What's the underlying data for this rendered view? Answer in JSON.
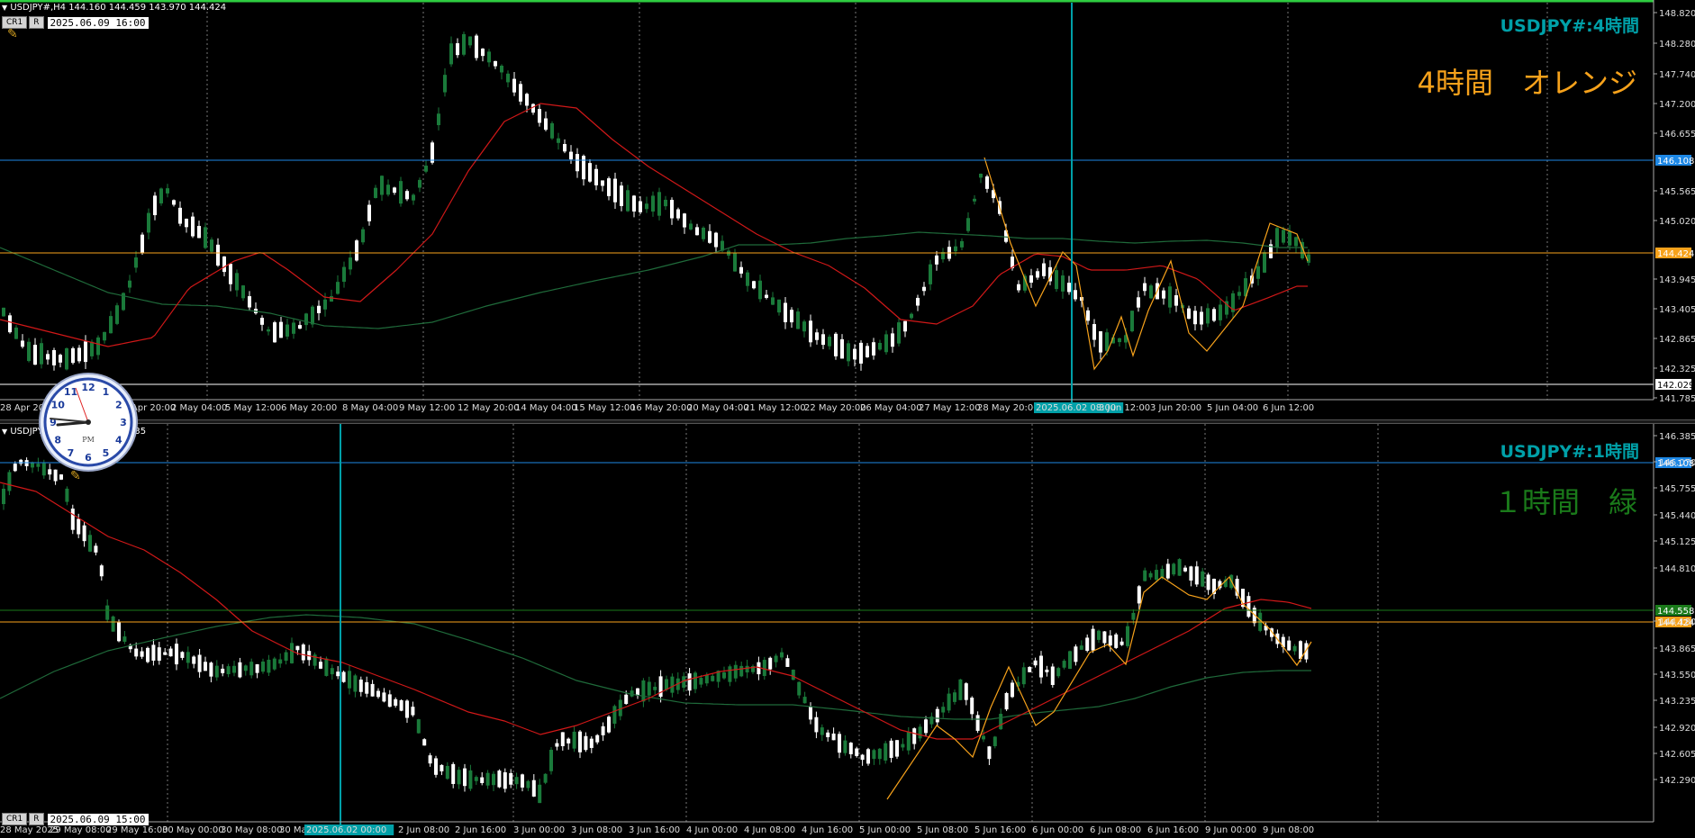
{
  "pane1": {
    "symbol_info": "USDJPY#,H4  144.160 144.459 143.970 144.424",
    "cr_label": "CR1",
    "r_label": "R",
    "date": "2025.06.09 16:00",
    "title": "USDJPY#:4時間",
    "note": "4時間　オレンジ",
    "note_color": "#f7a21b",
    "price_labels": [
      "148.820",
      "148.280",
      "147.740",
      "147.200",
      "146.655",
      "145.565",
      "145.020",
      "143.945",
      "143.405",
      "142.865",
      "142.325",
      "141.785"
    ],
    "h_lines": [
      {
        "price": "146.108",
        "color": "#1e88e5"
      },
      {
        "price": "144.424",
        "color": "#f7a21b"
      },
      {
        "price": "142.029",
        "color": "#ffffff"
      }
    ],
    "time_labels": [
      "28 Apr 2025",
      "30 Apr 20:00",
      "2 May 04:00",
      "5 May 12:00",
      "6 May 20:00",
      "8 May 04:00",
      "9 May 12:00",
      "12 May 20:00",
      "14 May 04:00",
      "15 May 12:00",
      "16 May 20:00",
      "20 May 04:00",
      "21 May 12:00",
      "22 May 20:00",
      "26 May 04:00",
      "27 May 12:00",
      "28 May 20:00",
      "2025.06.02 08:00",
      "3 Jun 12:00",
      "3 Jun 20:00",
      "5 Jun 04:00",
      "6 Jun 12:00"
    ]
  },
  "pane2": {
    "symbol_info": "USDJPY#,H1  144.154 144.435",
    "cr_label": "CR1",
    "r_label": "R",
    "date": "2025.06.09 15:00",
    "title": "USDJPY#:1時間",
    "note": "１時間　緑",
    "note_color": "#1a7a1a",
    "price_labels": [
      "146.385",
      "146.070",
      "145.755",
      "145.440",
      "145.125",
      "144.810",
      "144.180",
      "143.865",
      "143.550",
      "143.235",
      "142.920",
      "142.605",
      "142.290"
    ],
    "h_lines": [
      {
        "price": "146.108",
        "color": "#1e88e5"
      },
      {
        "price": "144.558",
        "color": "#1a7a1a"
      },
      {
        "price": "144.424",
        "color": "#f7a21b"
      }
    ],
    "time_labels": [
      "28 May 2025",
      "29 May 08:00",
      "29 May 16:00",
      "30 May 00:00",
      "30 May 08:00",
      "30 Ma",
      "2025.06.02 00:00",
      "2 Jun 08:00",
      "2 Jun 16:00",
      "3 Jun 00:00",
      "3 Jun 08:00",
      "3 Jun 16:00",
      "4 Jun 00:00",
      "4 Jun 08:00",
      "4 Jun 16:00",
      "5 Jun 00:00",
      "5 Jun 08:00",
      "5 Jun 16:00",
      "6 Jun 00:00",
      "6 Jun 08:00",
      "6 Jun 16:00",
      "9 Jun 00:00",
      "9 Jun 08:00"
    ]
  },
  "clock": {
    "period": "PM",
    "numbers": [
      "12",
      "1",
      "2",
      "3",
      "4",
      "5",
      "6",
      "7",
      "8",
      "9",
      "10",
      "11"
    ]
  },
  "colors": {
    "up": "#1a7a3a",
    "down": "#ffffff",
    "ma_fast": "#d01818",
    "ma_slow": "#1f6a3a",
    "zigzag": "#f7a21b",
    "cursor": "#00a0a8"
  }
}
